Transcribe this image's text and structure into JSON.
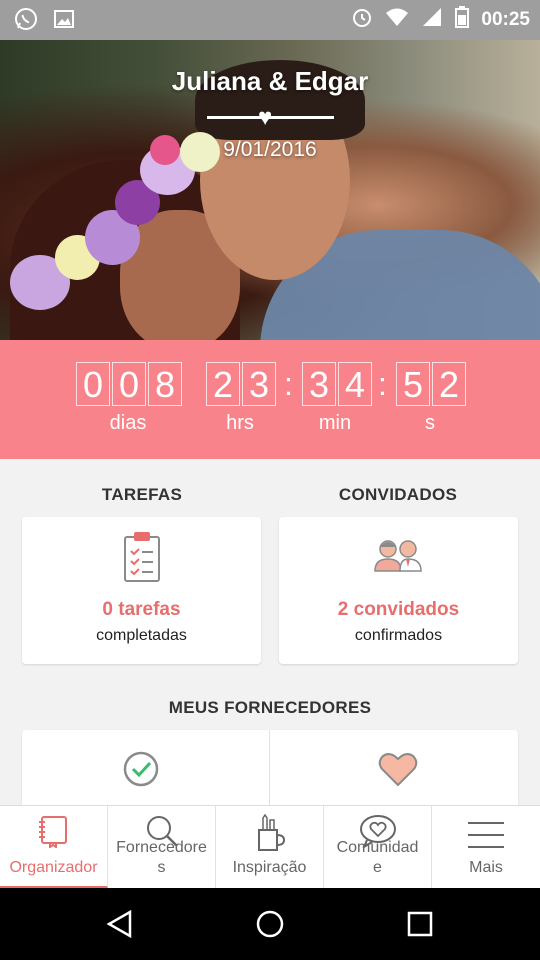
{
  "status_bar": {
    "time": "00:25"
  },
  "hero": {
    "couple_name": "Juliana & Edgar",
    "date": "9/01/2016"
  },
  "countdown": {
    "days_digits": [
      "0",
      "0",
      "8"
    ],
    "hours_digits": [
      "2",
      "3"
    ],
    "minutes_digits": [
      "3",
      "4"
    ],
    "seconds_digits": [
      "5",
      "2"
    ],
    "days_label": "dias",
    "hours_label": "hrs",
    "minutes_label": "min",
    "seconds_label": "s"
  },
  "tasks": {
    "title": "TAREFAS",
    "count": "0 tarefas",
    "sub": "completadas"
  },
  "guests": {
    "title": "CONVIDADOS",
    "count": "2 convidados",
    "sub": "confirmados"
  },
  "vendors": {
    "title": "MEUS FORNECEDORES"
  },
  "bottom_nav": [
    {
      "label": "Organizador"
    },
    {
      "label": "Fornecedore\ns"
    },
    {
      "label": "Inspiração"
    },
    {
      "label": "Comunidad\ne"
    },
    {
      "label": "Mais"
    }
  ],
  "colors": {
    "accent": "#f8838b",
    "accent_text": "#e86e6e",
    "status_bar": "#9e9e9e"
  }
}
